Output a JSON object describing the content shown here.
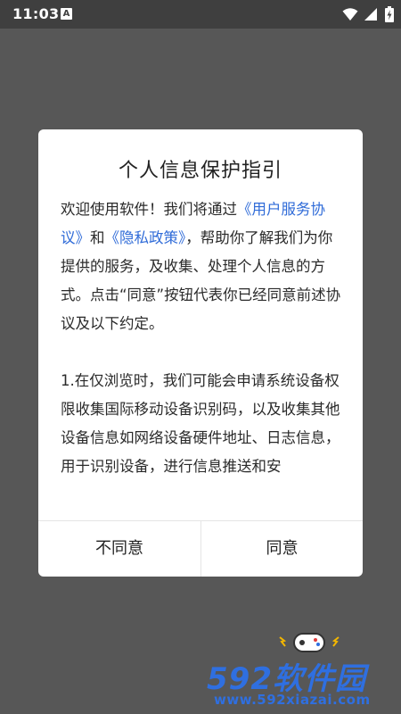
{
  "status_bar": {
    "time": "11:03",
    "notification_glyph": "A",
    "icons": [
      "notification-icon",
      "wifi-icon",
      "signal-icon",
      "battery-charging-icon"
    ]
  },
  "dialog": {
    "title": "个人信息保护指引",
    "paragraph1": {
      "part1": "欢迎使用软件！我们将通过",
      "link_terms": "《用户服务协议》",
      "part2": "和",
      "link_privacy": "《隐私政策》",
      "part3": "，帮助你了解我们为你提供的服务，及收集、处理个人信息的方式。点击“同意”按钮代表你已经同意前述协议及以下约定。"
    },
    "paragraph2": "1.在仅浏览时，我们可能会申请系统设备权限收集国际移动设备识别码，以及收集其他设备信息如网络设备硬件地址、日志信息，用于识别设备，进行信息推送和安",
    "buttons": {
      "disagree": "不同意",
      "agree": "同意"
    }
  },
  "watermark": {
    "brand": "592软件园",
    "url": "www.592xiazai.com"
  },
  "colors": {
    "link": "#2f6bd8",
    "overlay": "#575757",
    "watermark": "#2f6fe0"
  }
}
